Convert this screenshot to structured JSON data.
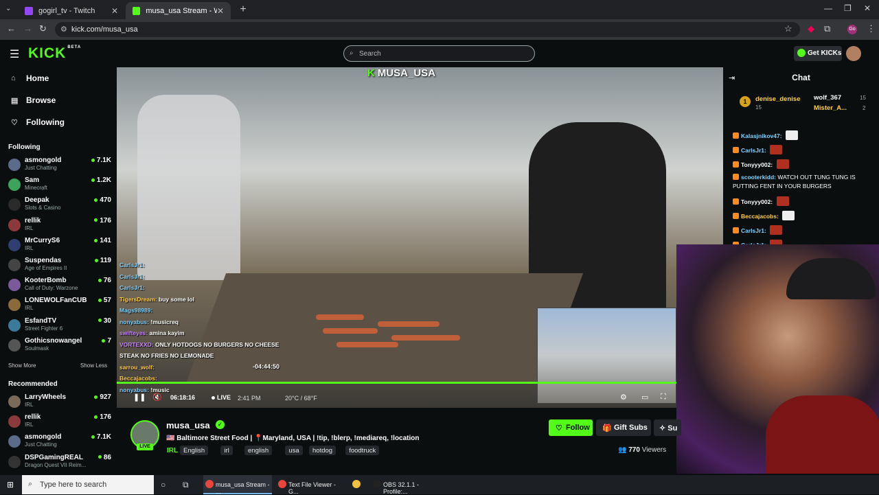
{
  "browser": {
    "tabs": [
      {
        "title": "gogirl_tv - Twitch",
        "favicon_color": "#9146ff"
      },
      {
        "title": "musa_usa Stream - Watch Live",
        "favicon_color": "#53fc18"
      }
    ],
    "url": "kick.com/musa_usa"
  },
  "header": {
    "logo": "KICK",
    "logo_badge": "BETA",
    "search_placeholder": "Search",
    "get_kicks_label": "Get KICKs"
  },
  "sidebar": {
    "nav": [
      {
        "label": "Home",
        "icon": "home-icon"
      },
      {
        "label": "Browse",
        "icon": "browse-icon"
      },
      {
        "label": "Following",
        "icon": "heart-icon"
      }
    ],
    "following_header": "Following",
    "following": [
      {
        "name": "asmongold",
        "category": "Just Chatting",
        "viewers": "7.1K",
        "color": "#5b6b8a"
      },
      {
        "name": "Sam",
        "category": "Minecraft",
        "viewers": "1.2K",
        "color": "#3ca35a"
      },
      {
        "name": "Deepak",
        "category": "Slots & Casino",
        "viewers": "470",
        "color": "#2a2a2a"
      },
      {
        "name": "rellik",
        "category": "IRL",
        "viewers": "176",
        "color": "#8a3a3a"
      },
      {
        "name": "MrCurryS6",
        "category": "IRL",
        "viewers": "141",
        "color": "#2f3f6f"
      },
      {
        "name": "Suspendas",
        "category": "Age of Empires II",
        "viewers": "119",
        "color": "#444"
      },
      {
        "name": "KooterBomb",
        "category": "Call of Duty: Warzone",
        "viewers": "76",
        "color": "#7a5a9a"
      },
      {
        "name": "LONEWOLFanCUB",
        "category": "IRL",
        "viewers": "57",
        "color": "#8a6a3a"
      },
      {
        "name": "EsfandTV",
        "category": "Street Fighter 6",
        "viewers": "30",
        "color": "#3a7a9a"
      },
      {
        "name": "Gothicsnowangel",
        "category": "Soulmask",
        "viewers": "7",
        "color": "#555"
      }
    ],
    "show_more": "Show More",
    "show_less": "Show Less",
    "recommended_header": "Recommended",
    "recommended": [
      {
        "name": "LarryWheels",
        "category": "IRL",
        "viewers": "927",
        "color": "#7a6a5a"
      },
      {
        "name": "rellik",
        "category": "IRL",
        "viewers": "176",
        "color": "#8a3a3a"
      },
      {
        "name": "asmongold",
        "category": "Just Chatting",
        "viewers": "7.1K",
        "color": "#5b6b8a"
      },
      {
        "name": "DSPGamingREAL",
        "category": "Dragon Quest VII Reim...",
        "viewers": "86",
        "color": "#333"
      }
    ]
  },
  "video": {
    "overlay_name": "MUSA_USA",
    "overlay_chat": [
      {
        "user": "CarlsJr1:",
        "text": "",
        "cls": "u"
      },
      {
        "user": "CarlsJr1:",
        "text": "",
        "cls": "u"
      },
      {
        "user": "CarlsJr1:",
        "text": "",
        "cls": "u"
      },
      {
        "user": "TigersDream:",
        "text": "buy some lol",
        "cls": "u2"
      },
      {
        "user": "Mags98989:",
        "text": "",
        "cls": "u"
      },
      {
        "user": "nonyabus:",
        "text": "!musicreq",
        "cls": "u"
      },
      {
        "user": "swifteyes:",
        "text": "amina kayim",
        "cls": "u3"
      },
      {
        "user": "VORTEXXD:",
        "text": "ONLY HOTDOGS NO BURGERS NO CHEESE STEAK NO FRIES NO LEMONADE",
        "cls": "u3"
      },
      {
        "user": "sarrou_wolf:",
        "text": "",
        "cls": "u2"
      },
      {
        "user": "Beccajacobs:",
        "text": "",
        "cls": "u2"
      },
      {
        "user": "nonyabus:",
        "text": "!music",
        "cls": "u"
      }
    ],
    "progress": 1.0,
    "seek_tooltip": "-04:44:50",
    "time": "06:18:16",
    "live_label": "LIVE",
    "clock": "2:41 PM",
    "weather": "20°C / 68°F"
  },
  "chat": {
    "title": "Chat",
    "leaderboard": [
      {
        "rank": "1",
        "name": "denise_denise",
        "count": "15"
      },
      {
        "name": "wolf_367",
        "count": "15"
      },
      {
        "name": "Mister_A...",
        "count": "2"
      }
    ],
    "messages": [
      {
        "user": "Kalasjnikov47:",
        "text": "",
        "color": "#7fd3ff",
        "emote": "w"
      },
      {
        "user": "CarlsJr1:",
        "text": "",
        "color": "#7fd3ff",
        "emote": "r"
      },
      {
        "user": "Tonyyy002:",
        "text": "",
        "color": "#fff",
        "emote": "r"
      },
      {
        "user": "scooterkidd:",
        "text": "WATCH OUT TUNG TUNG IS PUTTING FENT IN YOUR BURGERS",
        "color": "#7fd3ff",
        "emote": ""
      },
      {
        "user": "Tonyyy002:",
        "text": "",
        "color": "#fff",
        "emote": "r"
      },
      {
        "user": "Beccajacobs:",
        "text": "",
        "color": "#ffcf40",
        "emote": "w"
      },
      {
        "user": "CarlsJr1:",
        "text": "",
        "color": "#7fd3ff",
        "emote": "r"
      },
      {
        "user": "CarlsJr1:",
        "text": "",
        "color": "#7fd3ff",
        "emote": "r"
      }
    ]
  },
  "channel": {
    "name": "musa_usa",
    "live_badge": "LIVE",
    "title": "🇺🇸 Baltimore Street Food | 📍Maryland, USA | !tip, !blerp, !mediareq, !location",
    "category": "IRL",
    "tags": [
      "English",
      "irl",
      "english",
      "usa",
      "hotdog",
      "foodtruck"
    ],
    "follow_label": "Follow",
    "gift_label": "Gift Subs",
    "sub_label": "Su",
    "viewers": "770",
    "viewers_label": "Viewers"
  },
  "taskbar": {
    "search_placeholder": "Type here to search",
    "apps": [
      {
        "label": "musa_usa Stream - ...",
        "color": "#e8453c",
        "active": true
      },
      {
        "label": "Text File Viewer - G...",
        "color": "#e8453c",
        "active": false
      },
      {
        "label": "",
        "color": "#f0c040",
        "active": false
      },
      {
        "label": "OBS 32.1.1 - Profile:...",
        "color": "#222",
        "active": false
      }
    ]
  }
}
